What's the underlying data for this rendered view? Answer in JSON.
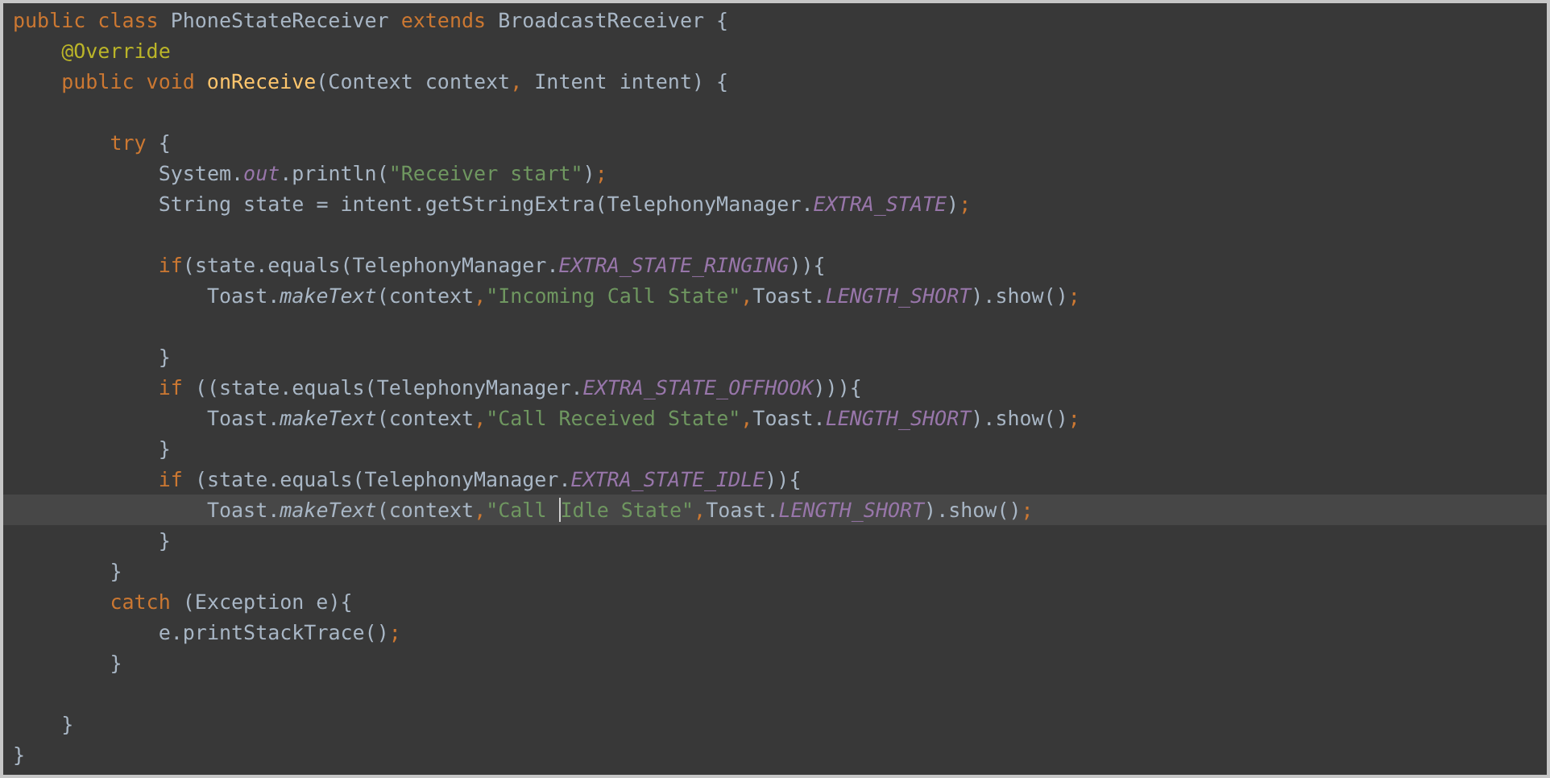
{
  "editor": {
    "lines": [
      {
        "kind": "code",
        "tokens": [
          {
            "kind": "keyword",
            "text": "public class "
          },
          {
            "kind": "plain",
            "text": "PhoneStateReceiver "
          },
          {
            "kind": "keyword",
            "text": "extends "
          },
          {
            "kind": "plain",
            "text": "BroadcastReceiver {"
          }
        ],
        "children": [
          {
            "kind": "code",
            "tokens": [
              {
                "kind": "annotation",
                "text": "@Override"
              }
            ]
          },
          {
            "kind": "code",
            "tokens": [
              {
                "kind": "keyword",
                "text": "public void "
              },
              {
                "kind": "method",
                "text": "onReceive"
              },
              {
                "kind": "plain",
                "text": "(Context context"
              },
              {
                "kind": "punct",
                "text": ", "
              },
              {
                "kind": "plain",
                "text": "Intent intent) {"
              }
            ],
            "children": [
              {
                "kind": "blank"
              },
              {
                "kind": "code",
                "tokens": [
                  {
                    "kind": "keyword",
                    "text": "try "
                  },
                  {
                    "kind": "plain",
                    "text": "{"
                  }
                ],
                "children": [
                  {
                    "kind": "code",
                    "tokens": [
                      {
                        "kind": "plain",
                        "text": "System."
                      },
                      {
                        "kind": "static",
                        "text": "out"
                      },
                      {
                        "kind": "plain",
                        "text": ".println("
                      },
                      {
                        "kind": "string",
                        "text": "\"Receiver start\""
                      },
                      {
                        "kind": "plain",
                        "text": ")"
                      },
                      {
                        "kind": "punct",
                        "text": ";"
                      }
                    ]
                  },
                  {
                    "kind": "code",
                    "tokens": [
                      {
                        "kind": "plain",
                        "text": "String state = intent.getStringExtra(TelephonyManager."
                      },
                      {
                        "kind": "static",
                        "text": "EXTRA_STATE"
                      },
                      {
                        "kind": "plain",
                        "text": ")"
                      },
                      {
                        "kind": "punct",
                        "text": ";"
                      }
                    ]
                  },
                  {
                    "kind": "blank"
                  },
                  {
                    "kind": "code",
                    "tokens": [
                      {
                        "kind": "keyword",
                        "text": "if"
                      },
                      {
                        "kind": "plain",
                        "text": "(state.equals(TelephonyManager."
                      },
                      {
                        "kind": "static",
                        "text": "EXTRA_STATE_RINGING"
                      },
                      {
                        "kind": "plain",
                        "text": ")){"
                      }
                    ],
                    "children": [
                      {
                        "kind": "code",
                        "tokens": [
                          {
                            "kind": "plain",
                            "text": "Toast."
                          },
                          {
                            "kind": "italic",
                            "text": "makeText"
                          },
                          {
                            "kind": "plain",
                            "text": "(context"
                          },
                          {
                            "kind": "punct",
                            "text": ","
                          },
                          {
                            "kind": "string",
                            "text": "\"Incoming Call State\""
                          },
                          {
                            "kind": "punct",
                            "text": ","
                          },
                          {
                            "kind": "plain",
                            "text": "Toast."
                          },
                          {
                            "kind": "static",
                            "text": "LENGTH_SHORT"
                          },
                          {
                            "kind": "plain",
                            "text": ").show()"
                          },
                          {
                            "kind": "punct",
                            "text": ";"
                          }
                        ]
                      },
                      {
                        "kind": "blank"
                      }
                    ]
                  },
                  {
                    "kind": "code",
                    "tokens": [
                      {
                        "kind": "plain",
                        "text": "}"
                      }
                    ]
                  },
                  {
                    "kind": "code",
                    "tokens": [
                      {
                        "kind": "keyword",
                        "text": "if "
                      },
                      {
                        "kind": "plain",
                        "text": "((state.equals(TelephonyManager."
                      },
                      {
                        "kind": "static",
                        "text": "EXTRA_STATE_OFFHOOK"
                      },
                      {
                        "kind": "plain",
                        "text": "))){"
                      }
                    ],
                    "children": [
                      {
                        "kind": "code",
                        "tokens": [
                          {
                            "kind": "plain",
                            "text": "Toast."
                          },
                          {
                            "kind": "italic",
                            "text": "makeText"
                          },
                          {
                            "kind": "plain",
                            "text": "(context"
                          },
                          {
                            "kind": "punct",
                            "text": ","
                          },
                          {
                            "kind": "string",
                            "text": "\"Call Received State\""
                          },
                          {
                            "kind": "punct",
                            "text": ","
                          },
                          {
                            "kind": "plain",
                            "text": "Toast."
                          },
                          {
                            "kind": "static",
                            "text": "LENGTH_SHORT"
                          },
                          {
                            "kind": "plain",
                            "text": ").show()"
                          },
                          {
                            "kind": "punct",
                            "text": ";"
                          }
                        ]
                      }
                    ]
                  },
                  {
                    "kind": "code",
                    "tokens": [
                      {
                        "kind": "plain",
                        "text": "}"
                      }
                    ]
                  },
                  {
                    "kind": "code",
                    "tokens": [
                      {
                        "kind": "keyword",
                        "text": "if "
                      },
                      {
                        "kind": "plain",
                        "text": "(state.equals(TelephonyManager."
                      },
                      {
                        "kind": "static",
                        "text": "EXTRA_STATE_IDLE"
                      },
                      {
                        "kind": "plain",
                        "text": ")){"
                      }
                    ],
                    "children": [
                      {
                        "kind": "code",
                        "current": true,
                        "tokens": [
                          {
                            "kind": "plain",
                            "text": "Toast."
                          },
                          {
                            "kind": "italic",
                            "text": "makeText"
                          },
                          {
                            "kind": "plain",
                            "text": "(context"
                          },
                          {
                            "kind": "punct",
                            "text": ","
                          },
                          {
                            "kind": "string",
                            "text": "\"Call "
                          },
                          {
                            "kind": "string",
                            "text": "Idle State\"",
                            "caret_before": true
                          },
                          {
                            "kind": "punct",
                            "text": ","
                          },
                          {
                            "kind": "plain",
                            "text": "Toast."
                          },
                          {
                            "kind": "static",
                            "text": "LENGTH_SHORT"
                          },
                          {
                            "kind": "plain",
                            "text": ").show()"
                          },
                          {
                            "kind": "punct",
                            "text": ";"
                          }
                        ]
                      }
                    ]
                  },
                  {
                    "kind": "code",
                    "tokens": [
                      {
                        "kind": "plain",
                        "text": "}"
                      }
                    ]
                  }
                ]
              },
              {
                "kind": "code",
                "tokens": [
                  {
                    "kind": "plain",
                    "text": "}"
                  }
                ]
              },
              {
                "kind": "code",
                "tokens": [
                  {
                    "kind": "keyword",
                    "text": "catch "
                  },
                  {
                    "kind": "plain",
                    "text": "(Exception e){"
                  }
                ],
                "children": [
                  {
                    "kind": "code",
                    "tokens": [
                      {
                        "kind": "plain",
                        "text": "e.printStackTrace()"
                      },
                      {
                        "kind": "punct",
                        "text": ";"
                      }
                    ]
                  }
                ]
              },
              {
                "kind": "code",
                "tokens": [
                  {
                    "kind": "plain",
                    "text": "}"
                  }
                ]
              },
              {
                "kind": "blank"
              }
            ]
          },
          {
            "kind": "code",
            "tokens": [
              {
                "kind": "plain",
                "text": "}"
              }
            ]
          }
        ]
      },
      {
        "kind": "code",
        "tokens": [
          {
            "kind": "plain",
            "text": "}"
          }
        ]
      }
    ]
  }
}
